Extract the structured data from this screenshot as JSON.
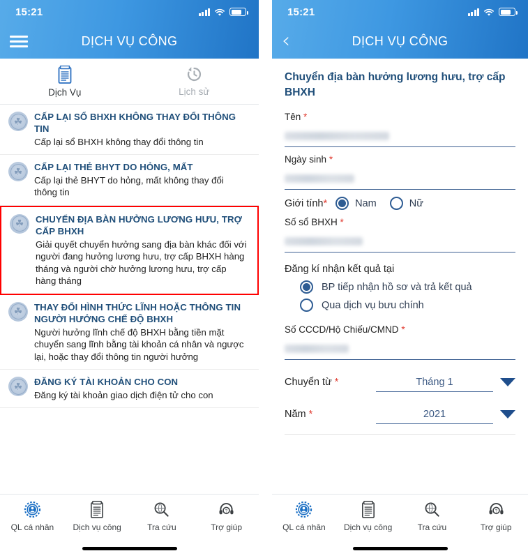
{
  "status_bar": {
    "time": "15:21",
    "icons": [
      "signal-icon",
      "wifi-icon",
      "battery-icon"
    ]
  },
  "left_screen": {
    "nav": {
      "menu_icon": "hamburger-icon",
      "title": "DỊCH VỤ CÔNG"
    },
    "tabs": [
      {
        "label": "Dịch Vụ",
        "icon": "document-icon",
        "active": true
      },
      {
        "label": "Lịch sử",
        "icon": "history-icon",
        "active": false
      }
    ],
    "services": [
      {
        "icon": "bhxh-seal-icon",
        "title": "CẤP LẠI SỔ BHXH KHÔNG THAY ĐỔI THÔNG TIN",
        "desc": "Cấp lại sổ BHXH không thay đổi thông tin",
        "highlighted": false
      },
      {
        "icon": "bhxh-seal-icon",
        "title": "CẤP LẠI THẺ BHYT DO HỎNG, MẤT",
        "desc": "Cấp lại thẻ BHYT do hỏng, mất không thay đổi thông tin",
        "highlighted": false
      },
      {
        "icon": "bhxh-seal-icon",
        "title": "CHUYỂN ĐỊA BÀN HƯỞNG LƯƠNG HƯU, TRỢ CẤP BHXH",
        "desc": "Giải quyết chuyển hưởng sang địa bàn khác đối với người đang hưởng lương hưu, trợ cấp BHXH hàng tháng và người chờ hưởng lương hưu, trợ cấp hàng tháng",
        "highlighted": true
      },
      {
        "icon": "bhxh-seal-icon",
        "title": "THAY ĐỔI HÌNH THỨC LĨNH HOẶC THÔNG TIN NGƯỜI HƯỞNG CHẾ ĐỘ BHXH",
        "desc": "Người hưởng lĩnh chế độ BHXH bằng tiền mặt chuyển sang lĩnh bằng tài khoản cá nhân và ngược lại, hoặc thay đổi thông tin người hưởng",
        "highlighted": false
      },
      {
        "icon": "bhxh-seal-icon",
        "title": "ĐĂNG KÝ TÀI KHOẢN CHO CON",
        "desc": "Đăng ký tài khoản giao dịch điện tử cho con",
        "highlighted": false
      }
    ]
  },
  "right_screen": {
    "nav": {
      "back_icon": "chevron-left-icon",
      "title": "DỊCH VỤ CÔNG"
    },
    "form_title": "Chuyển địa bàn hưởng lương hưu, trợ cấp BHXH",
    "fields": [
      {
        "label": "Tên",
        "required": true,
        "value": "",
        "redacted": true,
        "redact_width": 150
      },
      {
        "label": "Ngày sinh",
        "required": true,
        "value": "",
        "redacted": true,
        "redact_width": 100
      }
    ],
    "gender": {
      "label": "Giới tính",
      "required": true,
      "options": [
        {
          "label": "Nam",
          "selected": true
        },
        {
          "label": "Nữ",
          "selected": false
        }
      ]
    },
    "bhxh_number": {
      "label": "Số sổ BHXH",
      "required": true,
      "value": "",
      "redacted": true,
      "redact_width": 110
    },
    "result_delivery": {
      "label": "Đăng kí nhận kết quả tại",
      "options": [
        {
          "label": "BP tiếp nhận hồ sơ và trả kết quả",
          "selected": true
        },
        {
          "label": "Qua dịch vụ bưu chính",
          "selected": false
        }
      ]
    },
    "id_number": {
      "label": "Số CCCD/Hộ Chiếu/CMND",
      "required": true,
      "value": "",
      "redacted": true,
      "redact_width": 92
    },
    "selects": [
      {
        "label": "Chuyển từ",
        "required": true,
        "value": "Tháng 1",
        "caret_icon": "chevron-down-icon"
      },
      {
        "label": "Năm",
        "required": true,
        "value": "2021",
        "caret_icon": "chevron-down-icon"
      }
    ]
  },
  "bottom_nav": [
    {
      "label": "QL cá nhân",
      "icon": "personal-account-icon",
      "active": true
    },
    {
      "label": "Dịch vụ công",
      "icon": "public-service-icon",
      "active": false
    },
    {
      "label": "Tra cứu",
      "icon": "lookup-search-icon",
      "active": false
    },
    {
      "label": "Trợ giúp",
      "icon": "headset-help-icon",
      "active": false
    }
  ],
  "colors": {
    "header_gradient_start": "#57abe9",
    "header_gradient_end": "#2074c6",
    "title_blue": "#1f4e79",
    "highlight_red": "#ff0000",
    "required_red": "#e03a2f",
    "field_underline": "#3c5f91",
    "radio_blue": "#2e5c93",
    "inactive_gray": "#a7adb3"
  }
}
